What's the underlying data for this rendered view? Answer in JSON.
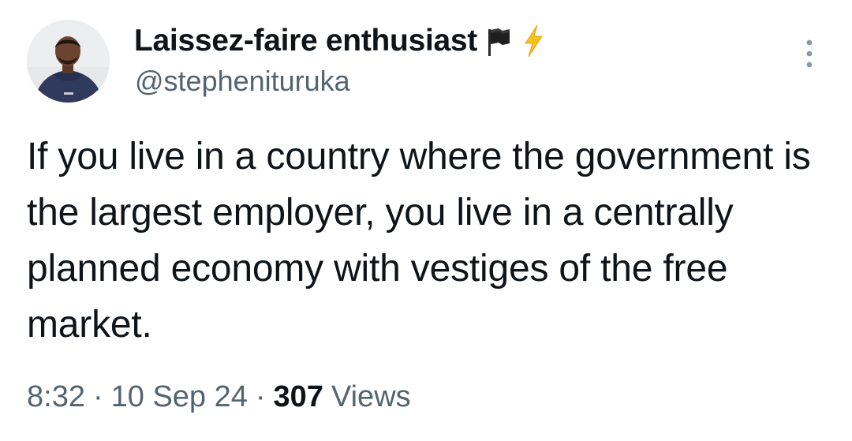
{
  "author": {
    "display_name": "Laissez-faire enthusiast",
    "handle": "@stephenituruka",
    "badges": [
      "black-flag-icon",
      "lightning-bolt-icon"
    ]
  },
  "tweet": {
    "text": "If you live in a country where the government is the largest employer, you live in a centrally planned economy with vestiges of the free market."
  },
  "meta": {
    "time": "8:32",
    "separator": "·",
    "date": "10 Sep 24",
    "views_count": "307",
    "views_label": "Views"
  },
  "icons": {
    "more": "more-vertical-icon"
  },
  "colors": {
    "text_primary": "#0f1419",
    "text_secondary": "#536471",
    "bolt": "#f4c21c",
    "background": "#ffffff"
  }
}
